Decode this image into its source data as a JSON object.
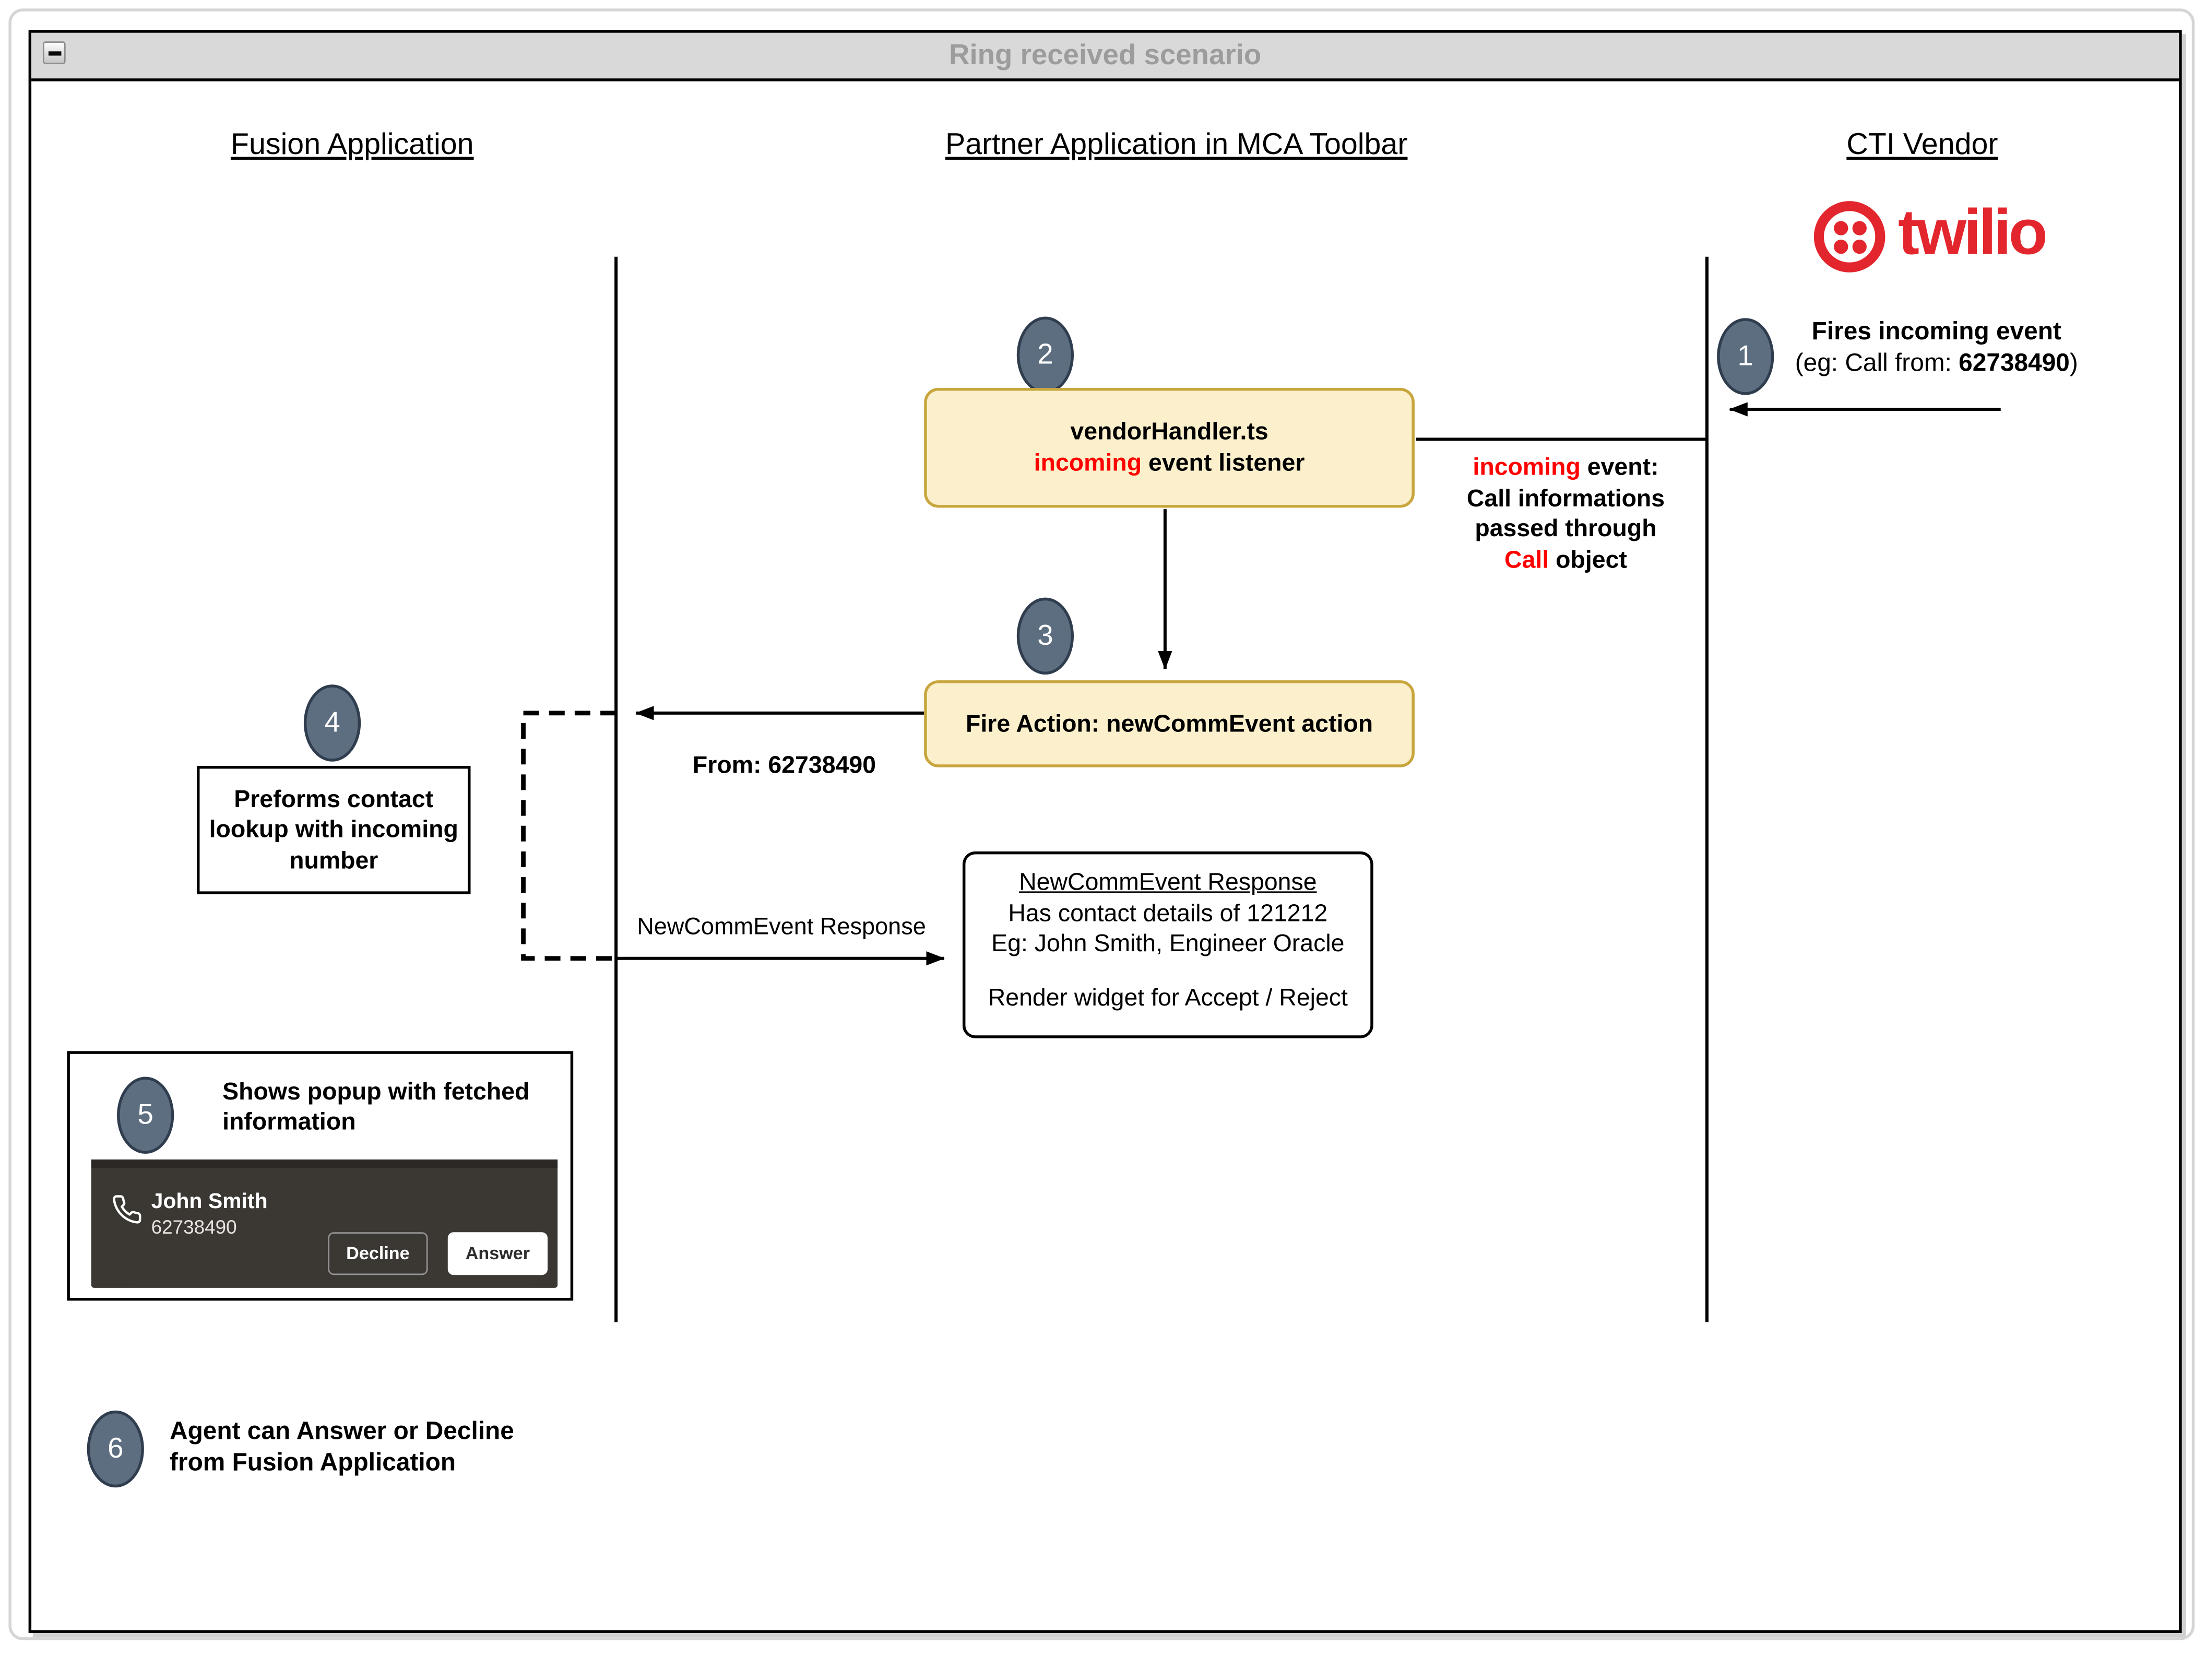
{
  "window": {
    "title": "Ring received scenario"
  },
  "lanes": {
    "fusion": "Fusion Application",
    "partner": "Partner Application in MCA Toolbar",
    "cti": "CTI Vendor"
  },
  "twilio_wordmark": "twilio",
  "step1": {
    "num": "1",
    "title": "Fires incoming event",
    "example_prefix": "(eg: Call from: ",
    "example_number": "62738490",
    "example_suffix": ")"
  },
  "step2": {
    "num": "2"
  },
  "step3": {
    "num": "3"
  },
  "step4": {
    "num": "4",
    "line1": "Preforms contact",
    "line2": "lookup with incoming",
    "line3": "number"
  },
  "step5": {
    "num": "5",
    "label": "Shows popup with fetched information"
  },
  "step6": {
    "num": "6",
    "line1": "Agent can Answer or Decline",
    "line2": "from Fusion Application"
  },
  "vendor_handler": {
    "line1": "vendorHandler.ts",
    "keyword": "incoming",
    "line2_rest": " event listener"
  },
  "incoming_note": {
    "keyword1": "incoming",
    "line1_rest": " event:",
    "line2": "Call informations",
    "line3": "passed through",
    "keyword2": "Call",
    "line4_rest": " object"
  },
  "fire_action": {
    "label": "Fire Action: newCommEvent action"
  },
  "messages": {
    "from_label": "From: 62738490",
    "response_label": "NewCommEvent Response"
  },
  "response_box": {
    "title": "NewCommEvent Response",
    "line1": "Has contact details of 121212",
    "line2": "Eg: John Smith, Engineer Oracle",
    "line3": "Render widget for Accept / Reject"
  },
  "popup": {
    "contact_name": "John Smith",
    "contact_number": "62738490",
    "decline_label": "Decline",
    "answer_label": "Answer"
  },
  "colors": {
    "process_fill": "#FCF0CC",
    "process_border": "#C8A63E",
    "badge_fill": "#5D6E81",
    "badge_border": "#2F3D4E",
    "highlight_red": "#FF0000",
    "twilio_red": "#E3262D",
    "popup_bg": "#3B3733",
    "titlebar_bg": "#D9D9D9"
  }
}
